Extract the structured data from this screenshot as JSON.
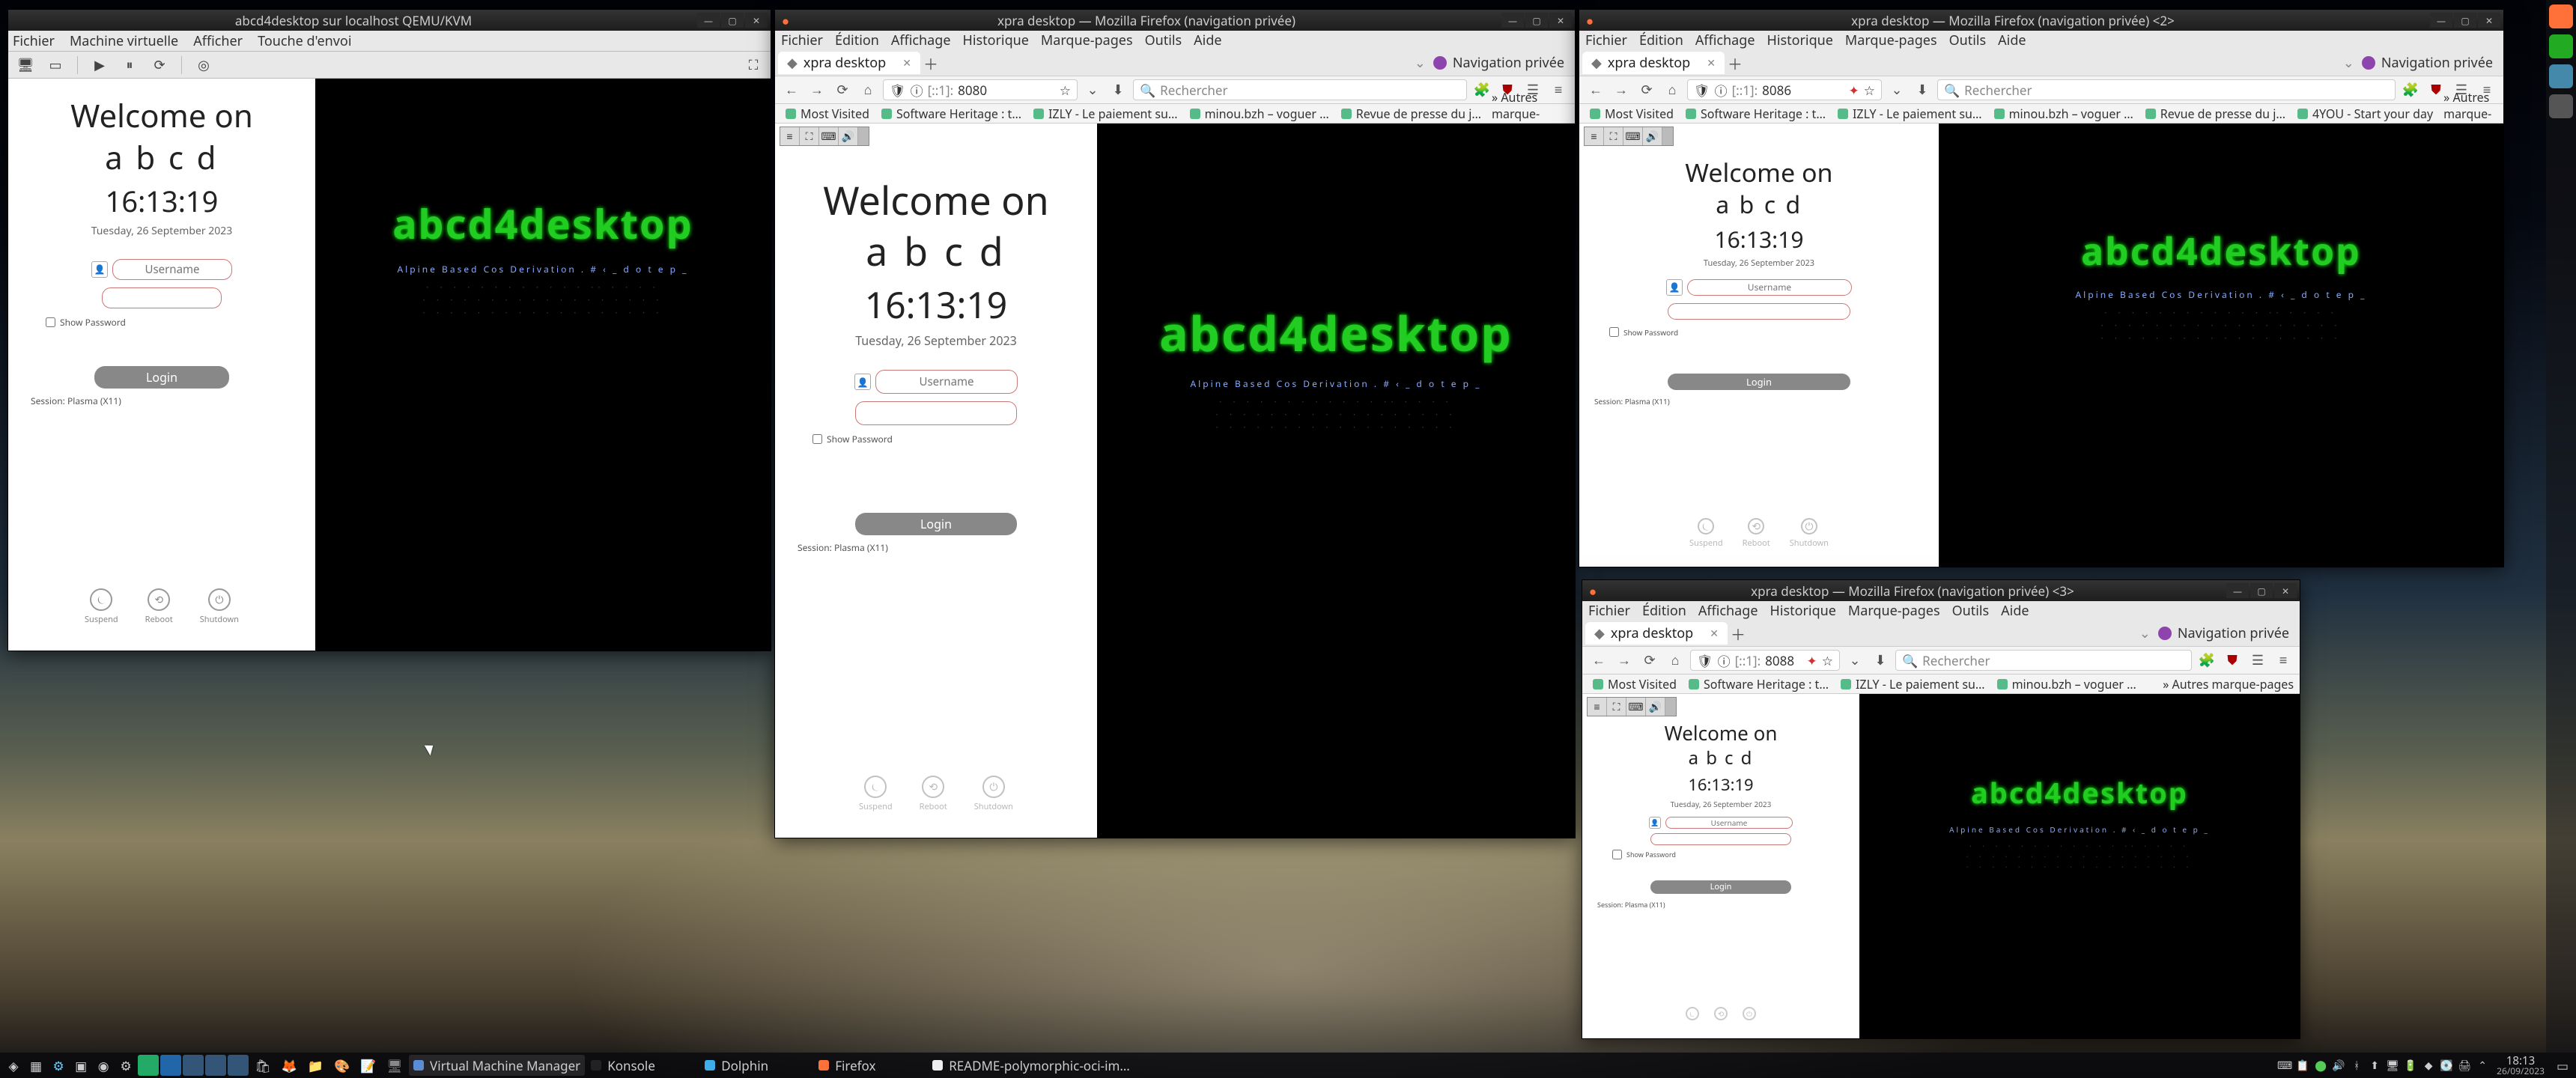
{
  "wallpaper": {
    "desc": "Earth surface from orbit with stars above"
  },
  "qemu_window": {
    "title": "abcd4desktop sur localhost QEMU/KVM",
    "menu": [
      "Fichier",
      "Machine virtuelle",
      "Afficher",
      "Touche d'envoi"
    ],
    "toolbar_icons": [
      "monitor",
      "play",
      "pause",
      "power-cycle",
      "fullscreen"
    ]
  },
  "guest": {
    "welcome": "Welcome on",
    "hostname": "a b c d",
    "time": "16:13:19",
    "date": "Tuesday, 26 September 2023",
    "username_placeholder": "Username",
    "password_placeholder": "",
    "show_password_label": "Show Password",
    "login_label": "Login",
    "session_label": "Session: Plasma (X11)",
    "power": {
      "suspend": "Suspend",
      "reboot": "Reboot",
      "shutdown": "Shutdown"
    },
    "ascii_logo": "abcd4desktop",
    "distro_row": "Alpine   Based   Cos   Derivation   . # ‹ _ d o t e p _",
    "blue_art_1": "· ·  ·  · ·  · · · ·  · ·  ·   ··  ·  · · ·",
    "blue_art_2": "· ·  · ·  · ·  ·  · ·  · ·  ·  · ·  ·  · · ·",
    "blue_art_3": "·  · · ·  ·  · · ·  · ·  · ·  · · ·  ·  · ·"
  },
  "firefox_common": {
    "menu": [
      "Fichier",
      "Édition",
      "Affichage",
      "Historique",
      "Marque-pages",
      "Outils",
      "Aide"
    ],
    "tab_label": "xpra desktop",
    "priv_label": "Navigation privée",
    "search_placeholder": "Rechercher",
    "url_host": "[::1]:",
    "bookmarks": [
      "Most Visited",
      "Software Heritage : t…",
      "IZLY - Le paiement su…",
      "minou.bzh – voguer …",
      "Revue de presse du j…",
      "4YOU - Start your day"
    ],
    "more_bm": "Autres marque-pages"
  },
  "ff1": {
    "title": "xpra desktop — Mozilla Firefox (navigation privée)",
    "port": "8080"
  },
  "ff2": {
    "title": "xpra desktop — Mozilla Firefox (navigation privée) <2>",
    "port": "8086"
  },
  "ff3": {
    "title": "xpra desktop — Mozilla Firefox (navigation privée) <3>",
    "port": "8088"
  },
  "taskbar": {
    "tasks": [
      {
        "icon": "#5b8dd6",
        "label": "Virtual Machine Manager"
      },
      {
        "icon": "#222",
        "label": "Konsole"
      },
      {
        "icon": "#3daee9",
        "label": "Dolphin"
      },
      {
        "icon": "#ff7139",
        "label": "Firefox"
      },
      {
        "icon": "#eee",
        "label": "README-polymorphic-oci-im…"
      }
    ],
    "time": "18:13",
    "date": "26/09/2023"
  },
  "colors": {
    "accent_green": "#22cc22",
    "input_border": "#cc7766",
    "login_btn": "#888888"
  }
}
